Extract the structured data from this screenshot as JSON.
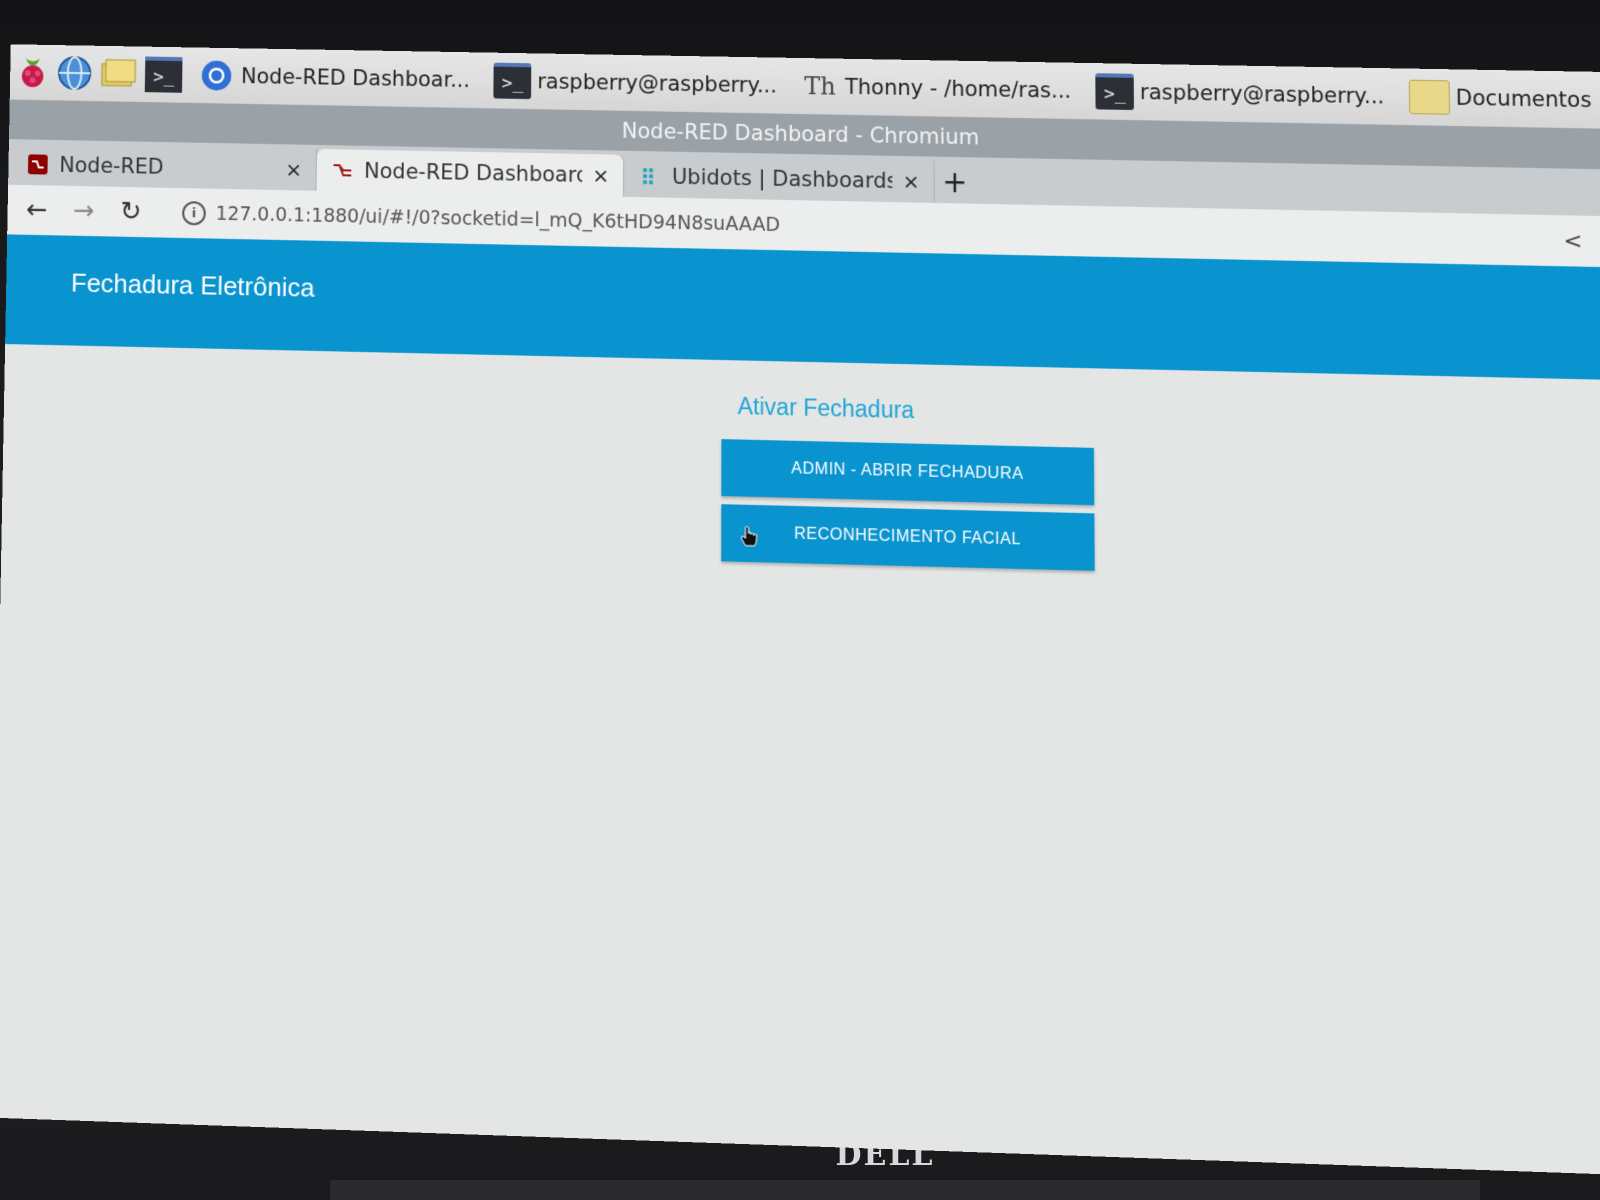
{
  "taskbar": {
    "launchers": [
      "raspberry-menu-icon",
      "web-browser-icon",
      "file-manager-icon",
      "terminal-icon"
    ],
    "tasks": [
      {
        "icon": "chromium-icon",
        "label": "Node-RED Dashboar..."
      },
      {
        "icon": "terminal-icon",
        "label": "raspberry@raspberry..."
      },
      {
        "icon": "thonny-icon",
        "label": "Thonny  -  /home/ras..."
      },
      {
        "icon": "terminal-icon",
        "label": "raspberry@raspberry..."
      },
      {
        "icon": "folder-icon",
        "label": "Documentos"
      }
    ],
    "tray_icon": "bluetooth-icon"
  },
  "window": {
    "title": "Node-RED Dashboard - Chromium"
  },
  "tabs": [
    {
      "icon": "node-red-icon",
      "label": "Node-RED",
      "close": "×",
      "active": false
    },
    {
      "icon": "node-red-dashboard-icon",
      "label": "Node-RED Dashboard",
      "close": "×",
      "active": true
    },
    {
      "icon": "ubidots-icon",
      "label": "Ubidots | Dashboards",
      "close": "×",
      "active": false
    }
  ],
  "new_tab_label": "+",
  "address_bar": {
    "url": "127.0.0.1:1880/ui/#!/0?socketid=l_mQ_K6tHD94N8suAAAD"
  },
  "dashboard": {
    "title": "Fechadura Eletrônica",
    "group_title": "Ativar Fechadura",
    "buttons": [
      {
        "label": "ADMIN - ABRIR FECHADURA"
      },
      {
        "label": "RECONHECIMENTO FACIAL"
      }
    ]
  },
  "monitor": {
    "brand": "DELL"
  },
  "colors": {
    "accent": "#0a94cf",
    "group_title": "#1ea4d6",
    "page_bg": "#e3e6e4"
  }
}
